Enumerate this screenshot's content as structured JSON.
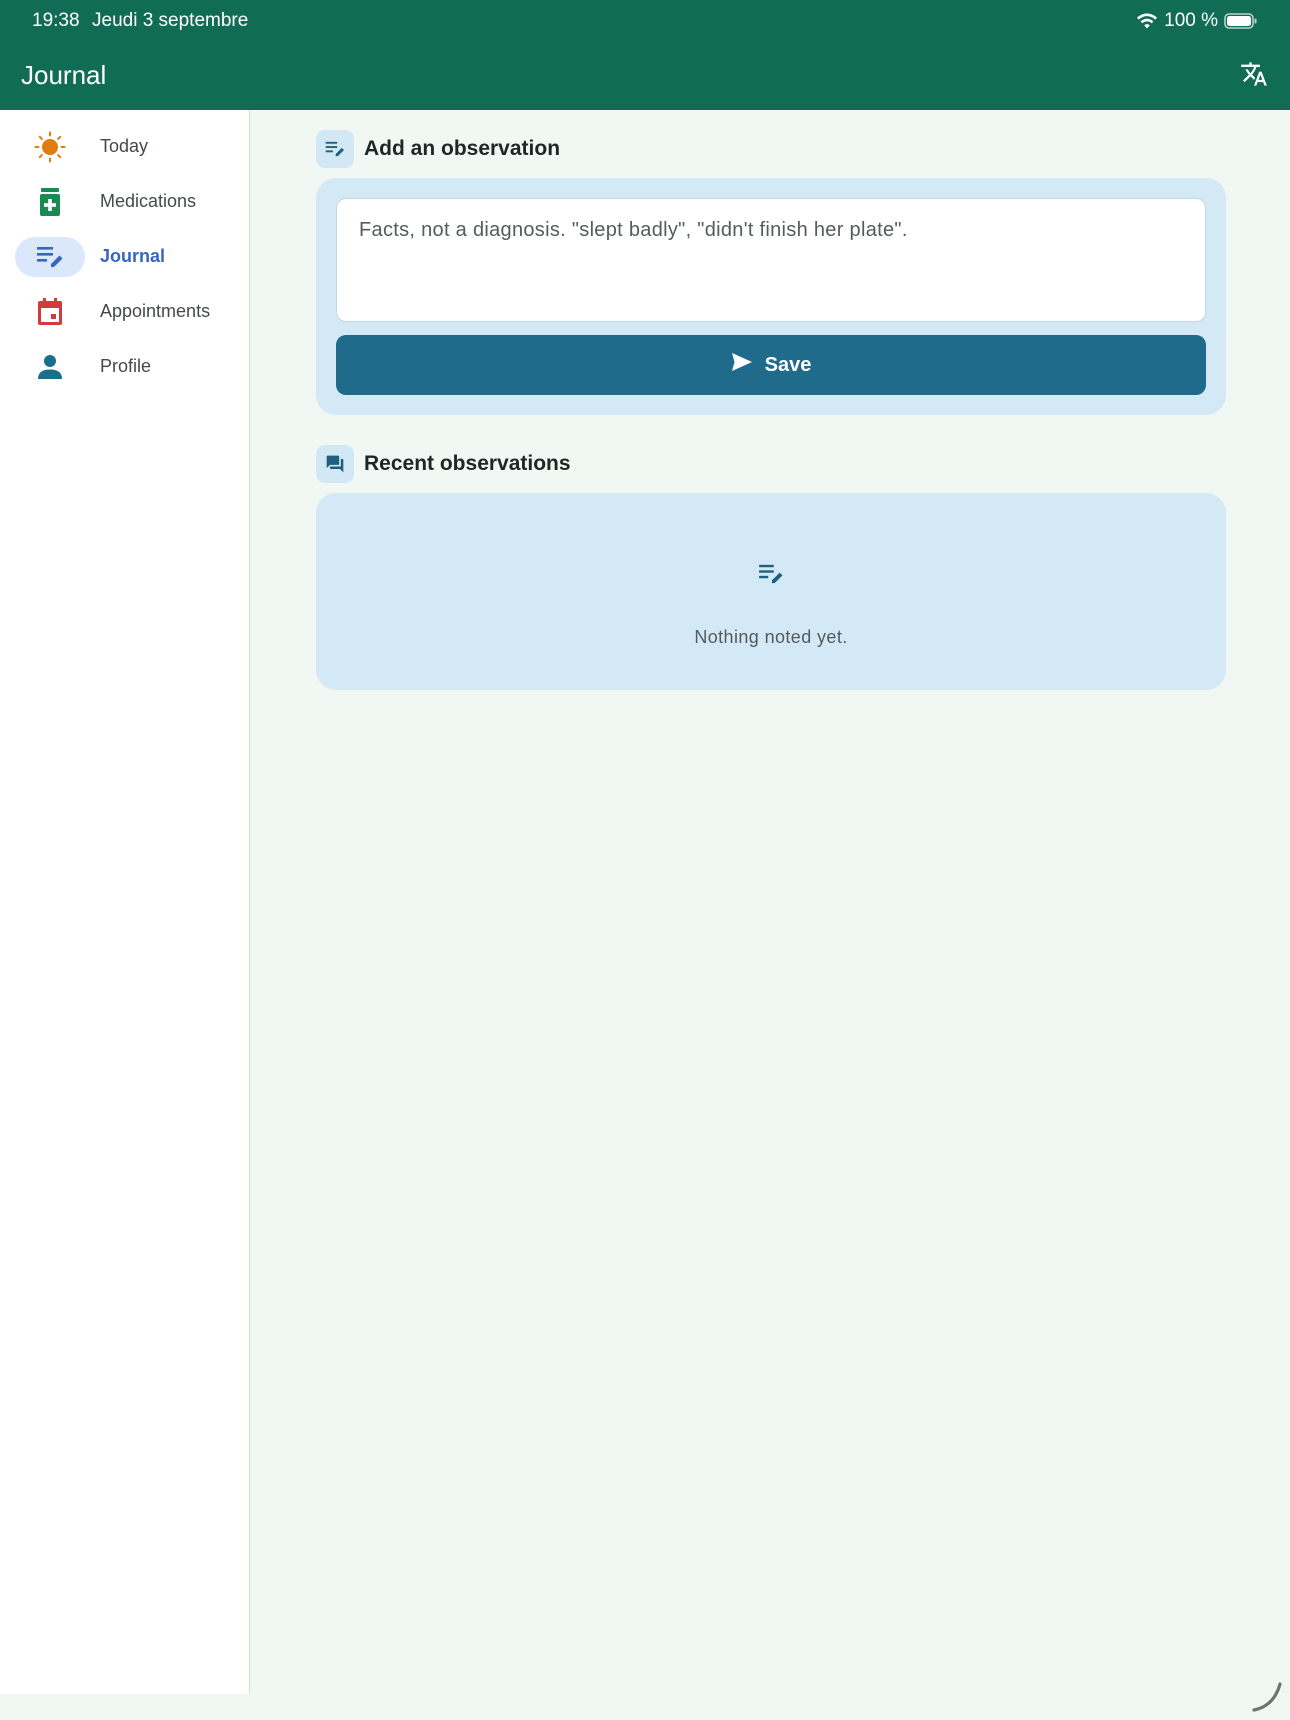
{
  "status_bar": {
    "time": "19:38",
    "date": "Jeudi 3 septembre",
    "battery": "100 %"
  },
  "app_bar": {
    "title": "Journal",
    "translate_icon": "translate-icon"
  },
  "sidebar": {
    "items": [
      {
        "label": "Today",
        "icon": "sun-icon",
        "color": "#e07b0f",
        "active": false
      },
      {
        "label": "Medications",
        "icon": "medication-icon",
        "color": "#1a8a52",
        "active": false
      },
      {
        "label": "Journal",
        "icon": "edit-note-icon",
        "color": "#3566c1",
        "active": true
      },
      {
        "label": "Appointments",
        "icon": "calendar-icon",
        "color": "#d23b3b",
        "active": false
      },
      {
        "label": "Profile",
        "icon": "person-icon",
        "color": "#1a6f8c",
        "active": false
      }
    ]
  },
  "add_section": {
    "title": "Add an observation",
    "icon": "edit-note-icon",
    "placeholder": "Facts, not a diagnosis. \"slept badly\", \"didn't finish her plate\".",
    "save_label": "Save",
    "save_icon": "send-icon"
  },
  "recent_section": {
    "title": "Recent observations",
    "icon": "forum-icon",
    "empty_text": "Nothing noted yet.",
    "empty_icon": "edit-note-icon"
  },
  "colors": {
    "app_bar": "#116c56",
    "card": "#d3e9f5",
    "button": "#206a8c",
    "active_nav": "#3566c1",
    "active_pill": "#dbe7fa",
    "background": "#f1f7f3"
  }
}
